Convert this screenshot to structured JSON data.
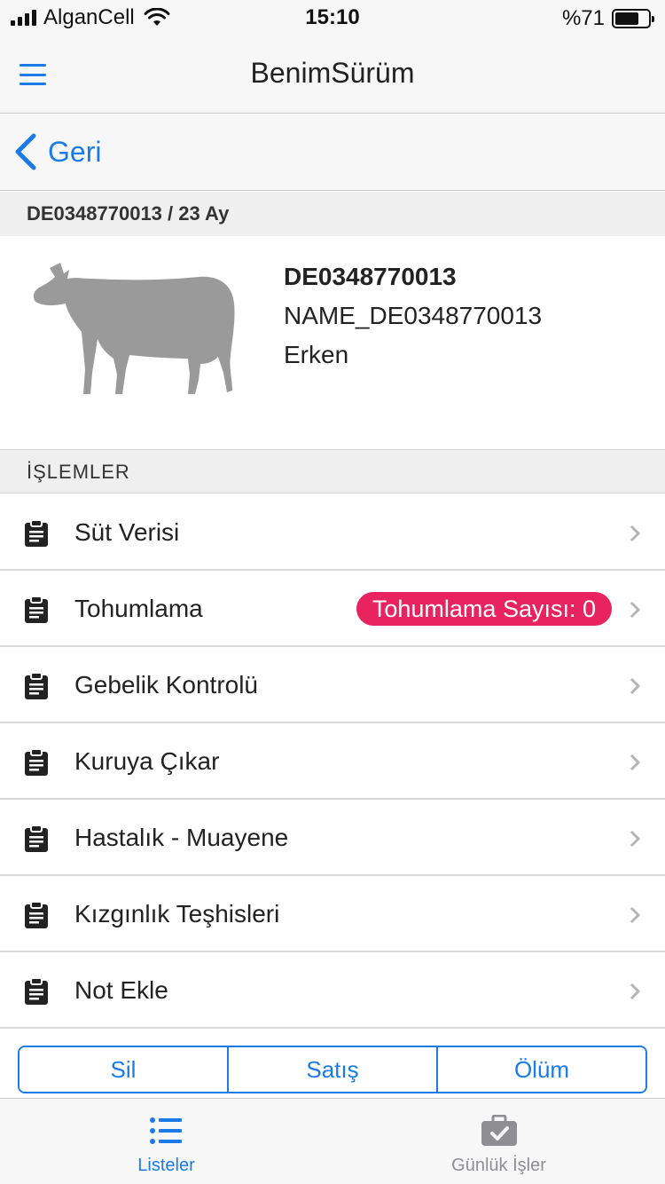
{
  "status_bar": {
    "carrier": "AlganCell",
    "time": "15:10",
    "battery": "%71",
    "battery_level": 0.71
  },
  "header": {
    "title": "BenimSürüm",
    "menu_icon": "hamburger-menu-icon"
  },
  "nav": {
    "back_label": "Geri",
    "back_icon": "chevron-left-icon"
  },
  "animal": {
    "section_title": "DE0348770013 / 23 Ay",
    "id": "DE0348770013",
    "name": "NAME_DE0348770013",
    "status": "Erken",
    "image_icon": "cow-silhouette-icon"
  },
  "operations": {
    "section_title": "İŞLEMLER",
    "items": [
      {
        "label": "Süt Verisi",
        "icon": "clipboard-icon"
      },
      {
        "label": "Tohumlama",
        "icon": "clipboard-icon",
        "badge": "Tohumlama Sayısı: 0"
      },
      {
        "label": "Gebelik Kontrolü",
        "icon": "clipboard-icon"
      },
      {
        "label": "Kuruya Çıkar",
        "icon": "clipboard-icon"
      },
      {
        "label": "Hastalık - Muayene",
        "icon": "clipboard-icon"
      },
      {
        "label": "Kızgınlık Teşhisleri",
        "icon": "clipboard-icon"
      },
      {
        "label": "Not Ekle",
        "icon": "clipboard-icon"
      }
    ]
  },
  "actions": {
    "delete": "Sil",
    "sale": "Satış",
    "death": "Ölüm"
  },
  "tabs": [
    {
      "label": "Listeler",
      "icon": "list-icon",
      "active": true
    },
    {
      "label": "Günlük İşler",
      "icon": "briefcase-check-icon",
      "active": false
    }
  ],
  "colors": {
    "accent": "#1a7be8",
    "badge": "#e8235f",
    "cow": "#9a9a9a"
  }
}
